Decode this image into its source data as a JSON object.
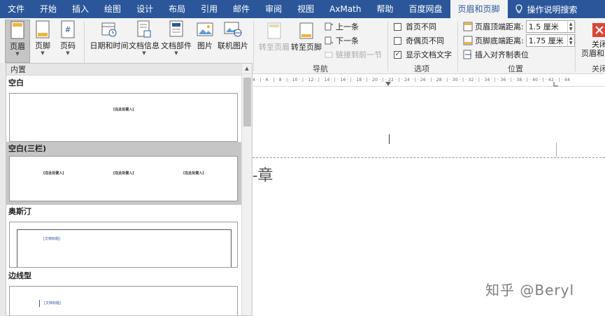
{
  "menu": {
    "tabs": [
      "文件",
      "开始",
      "插入",
      "绘图",
      "设计",
      "布局",
      "引用",
      "邮件",
      "审阅",
      "视图",
      "AxMath",
      "帮助",
      "百度网盘",
      "页眉和页脚"
    ],
    "tell_me": "操作说明搜索"
  },
  "ribbon": {
    "header_btn": "页眉",
    "footer_btn": "页脚",
    "pagenum_btn": "页码",
    "datetime_btn": "日期和时间",
    "docinfo_btn": "文档信息",
    "docparts_btn": "文档部件",
    "picture_btn": "图片",
    "online_pic_btn": "联机图片",
    "goto_header_btn": "转至页眉",
    "goto_footer_btn": "转至页脚",
    "prev_btn": "上一条",
    "next_btn": "下一条",
    "link_prev_btn": "链接到前一节",
    "nav_group": "导航",
    "opt_first_diff": "首页不同",
    "opt_odd_even": "奇偶页不同",
    "opt_show_doc": "显示文档文字",
    "opt_show_doc_checked": "✓",
    "options_group": "选项",
    "header_top_label": "页眉顶端距离:",
    "header_top_value": "1.5 厘米",
    "footer_bottom_label": "页脚底端距离:",
    "footer_bottom_value": "1.75 厘米",
    "insert_align_tab": "插入对齐制表位",
    "position_group": "位置",
    "close_btn_line1": "关闭",
    "close_btn_line2": "页眉和页",
    "close_group": "关闭"
  },
  "gallery": {
    "header": "内置",
    "sections": [
      {
        "title": "空白",
        "placeholders": [
          "[在此处键入]"
        ]
      },
      {
        "title": "空白(三栏)",
        "placeholders": [
          "[在此处键入]",
          "[在此处键入]",
          "[在此处键入]"
        ]
      },
      {
        "title": "奥斯汀",
        "placeholders": [
          "[文档标题]"
        ]
      },
      {
        "title": "边线型",
        "placeholders": [
          "[文档标题]"
        ]
      }
    ]
  },
  "ruler": {
    "ticks": "4 · | · 6 · | · 8 · | · 10 · | · 12 · | · 14 · | · 16 · | · 18 · | · 20 · | · 22 · | · 24 · | · 26 · | · 28 · | · 30 · | · 32 · | · 34 · | · 36 · | · 38 · | · 40 · | · 42 · | · 44"
  },
  "document": {
    "chapter_fragment": "-章"
  },
  "watermark": "知乎 @Beryl"
}
